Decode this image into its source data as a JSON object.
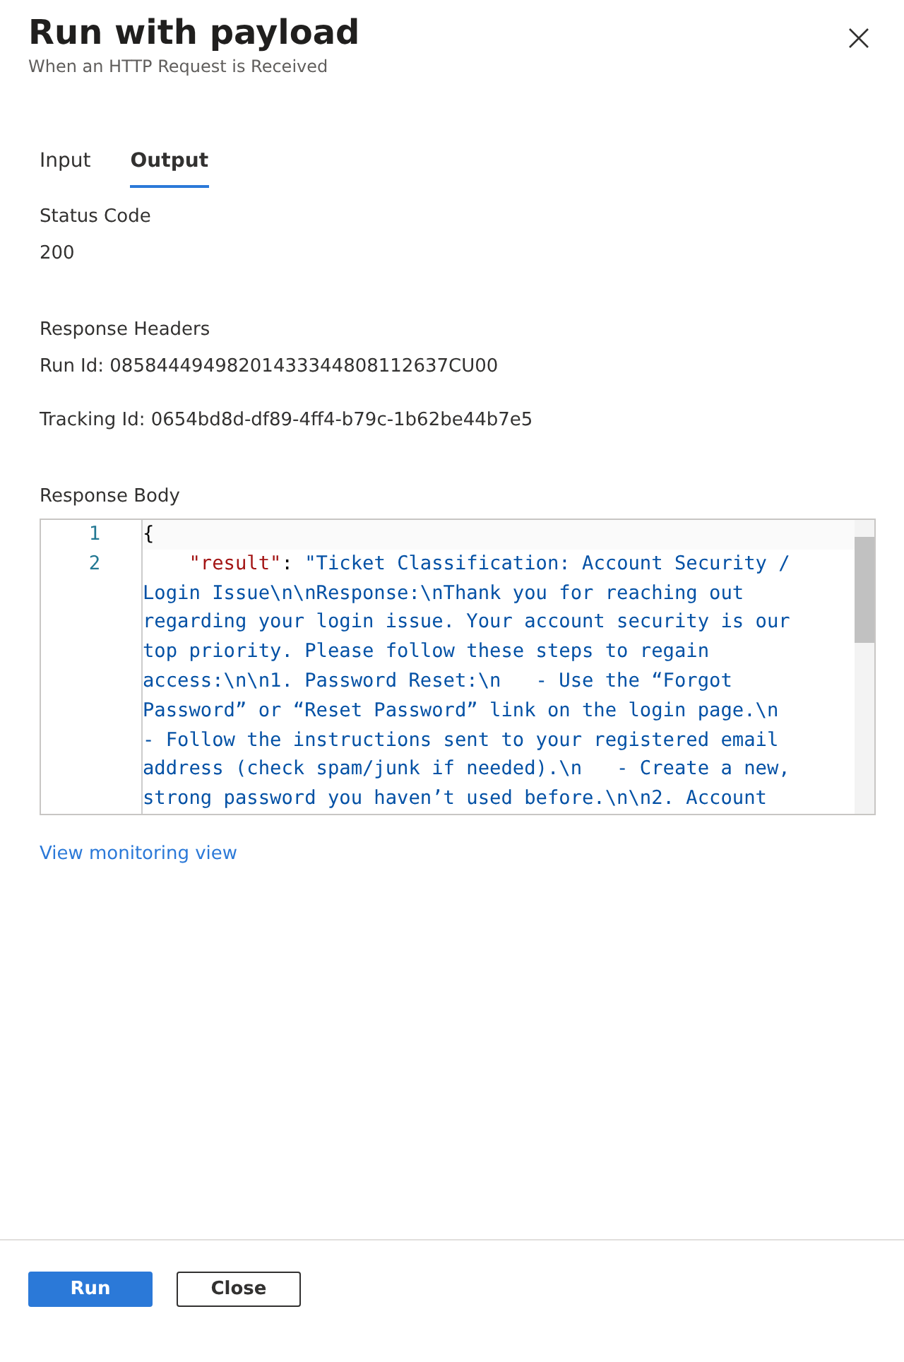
{
  "panel": {
    "title": "Run with payload",
    "subtitle": "When an HTTP Request is Received"
  },
  "tabs": [
    {
      "label": "Input",
      "selected": false
    },
    {
      "label": "Output",
      "selected": true
    }
  ],
  "status": {
    "label": "Status Code",
    "value": "200"
  },
  "headers": {
    "label": "Response Headers",
    "items": [
      "Run Id: 08584449498201433344808112637CU00",
      "Tracking Id: 0654bd8d-df89-4ff4-b79c-1b62be44b7e5"
    ]
  },
  "body": {
    "label": "Response Body",
    "lines": [
      {
        "number": "1",
        "kind": "punct",
        "text": "{"
      },
      {
        "number": "2",
        "kind": "pair",
        "key": "\"result\"",
        "sep": ": ",
        "value": "\"Ticket Classification: Account Security / Login Issue\\n\\nResponse:\\nThank you for reaching out regarding your login issue. Your account security is our top priority. Please follow these steps to regain access:\\n\\n1. Password Reset:\\n   - Use the “Forgot Password” or “Reset Password” link on the login page.\\n   - Follow the instructions sent to your registered email address (check spam/junk if needed).\\n   - Create a new, strong password you haven’t used before.\\n\\n2. Account"
      }
    ]
  },
  "link": "View monitoring view",
  "buttons": [
    {
      "label": "Run",
      "kind": "primary"
    },
    {
      "label": "Close",
      "kind": "secondary"
    }
  ]
}
